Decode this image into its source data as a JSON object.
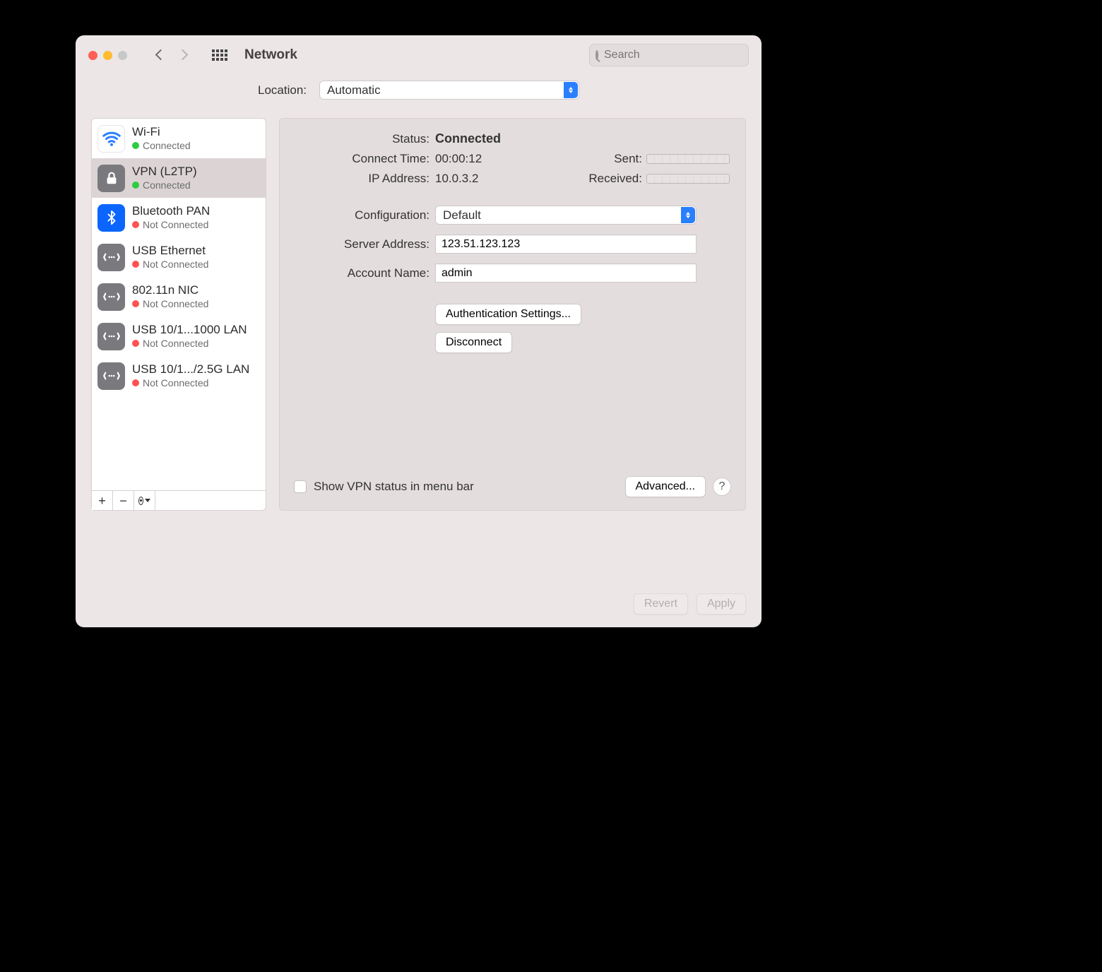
{
  "toolbar": {
    "title": "Network",
    "search_placeholder": "Search"
  },
  "location": {
    "label": "Location:",
    "value": "Automatic"
  },
  "sidebar": {
    "items": [
      {
        "name": "Wi-Fi",
        "status_label": "Connected",
        "dot": "green",
        "icon": "wifi"
      },
      {
        "name": "VPN (L2TP)",
        "status_label": "Connected",
        "dot": "green",
        "icon": "lock"
      },
      {
        "name": "Bluetooth PAN",
        "status_label": "Not Connected",
        "dot": "red",
        "icon": "bluetooth"
      },
      {
        "name": "USB Ethernet",
        "status_label": "Not Connected",
        "dot": "red",
        "icon": "ethernet"
      },
      {
        "name": "802.11n NIC",
        "status_label": "Not Connected",
        "dot": "red",
        "icon": "ethernet"
      },
      {
        "name": "USB 10/1...1000 LAN",
        "status_label": "Not Connected",
        "dot": "red",
        "icon": "ethernet"
      },
      {
        "name": "USB 10/1.../2.5G LAN",
        "status_label": "Not Connected",
        "dot": "red",
        "icon": "ethernet"
      }
    ],
    "selected_index": 1
  },
  "details": {
    "status_label": "Status:",
    "status_value": "Connected",
    "connect_time_label": "Connect Time:",
    "connect_time_value": "00:00:12",
    "ip_label": "IP Address:",
    "ip_value": "10.0.3.2",
    "sent_label": "Sent:",
    "received_label": "Received:",
    "config_label": "Configuration:",
    "config_value": "Default",
    "server_label": "Server Address:",
    "server_value": "123.51.123.123",
    "account_label": "Account Name:",
    "account_value": "admin",
    "auth_button": "Authentication Settings...",
    "disconnect_button": "Disconnect",
    "menubar_checkbox_label": "Show VPN status in menu bar",
    "advanced_button": "Advanced...",
    "help_button": "?"
  },
  "footer": {
    "revert": "Revert",
    "apply": "Apply"
  }
}
